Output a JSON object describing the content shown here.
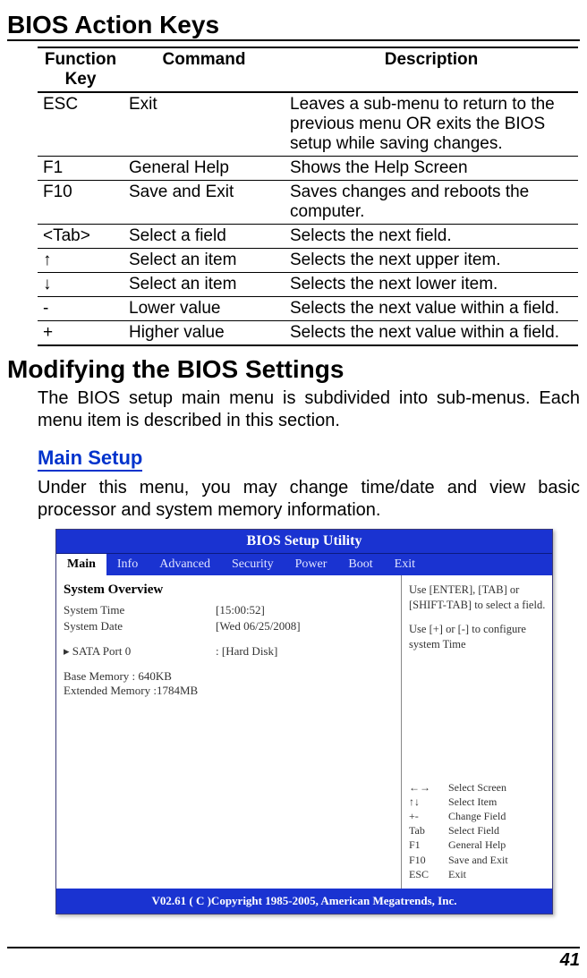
{
  "heading1": "BIOS Action Keys",
  "keys_table": {
    "headers": {
      "key": "Function Key",
      "cmd": "Command",
      "desc": "Description"
    },
    "rows": [
      {
        "key": "ESC",
        "cmd": "Exit",
        "desc": "Leaves a sub-menu to return to the previous menu OR exits the BIOS setup while saving changes."
      },
      {
        "key": "F1",
        "cmd": "General Help",
        "desc": "Shows the Help Screen"
      },
      {
        "key": "F10",
        "cmd": "Save and Exit",
        "desc": "Saves changes and reboots the computer."
      },
      {
        "key": "<Tab>",
        "cmd": "Select a field",
        "desc": "Selects the next field."
      },
      {
        "key": "↑",
        "cmd": "Select an item",
        "desc": "Selects the next upper item."
      },
      {
        "key": "↓",
        "cmd": "Select an item",
        "desc": "Selects the next lower item."
      },
      {
        "key": "-",
        "cmd": "Lower value",
        "desc": "Selects the next value within a field."
      },
      {
        "key": "+",
        "cmd": "Higher value",
        "desc": "Selects the next value within a field."
      }
    ]
  },
  "heading2": "Modifying the BIOS Settings",
  "para1": "The BIOS setup main menu is subdivided into sub-menus.  Each menu item is described in this section.",
  "heading3": "Main Setup",
  "para2": "Under this menu, you may change time/date and view basic processor and system memory information.",
  "bios": {
    "title": "BIOS Setup Utility",
    "tabs": [
      "Main",
      "Info",
      "Advanced",
      "Security",
      "Power",
      "Boot",
      "Exit"
    ],
    "active_tab": "Main",
    "overview_title": "System Overview",
    "fields": {
      "time_label": "System Time",
      "time_value": "[15:00:52]",
      "date_label": "System Date",
      "date_value": "[Wed 06/25/2008]",
      "sata_label": "▸ SATA Port 0",
      "sata_value": ": [Hard Disk]",
      "base_mem": "Base Memory : 640KB",
      "ext_mem": "Extended Memory :1784MB"
    },
    "help_top_1": "Use [ENTER], [TAB] or [SHIFT-TAB] to select a field.",
    "help_top_2": "Use [+] or [-] to configure system Time",
    "help_bottom": [
      {
        "k": "←→",
        "d": "Select Screen"
      },
      {
        "k": "↑↓",
        "d": "Select Item"
      },
      {
        "k": "+-",
        "d": "Change Field"
      },
      {
        "k": "Tab",
        "d": "Select Field"
      },
      {
        "k": "F1",
        "d": "General Help"
      },
      {
        "k": "F10",
        "d": "Save and Exit"
      },
      {
        "k": "ESC",
        "d": "Exit"
      }
    ],
    "footer": "V02.61 ( C )Copyright 1985-2005, American Megatrends, Inc."
  },
  "page_number": "41"
}
